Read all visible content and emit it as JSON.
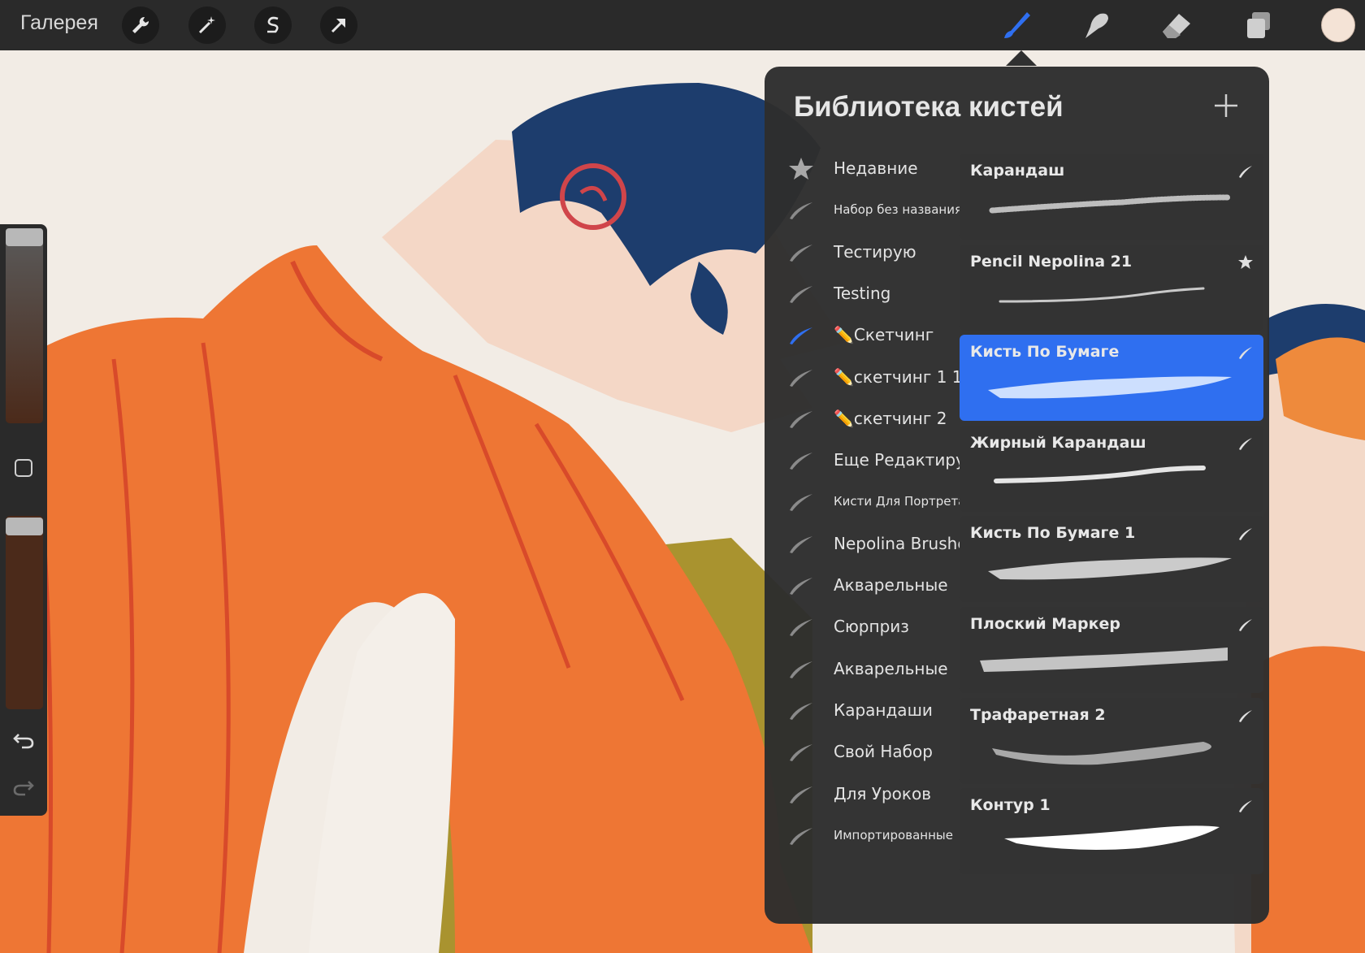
{
  "topbar": {
    "gallery_label": "Галерея",
    "left_tools": [
      "wrench-icon",
      "magic-wand-icon",
      "selection-s-icon",
      "transform-arrow-icon"
    ],
    "right_tools": [
      "brush-icon",
      "smudge-icon",
      "eraser-icon",
      "layers-icon"
    ],
    "current_color": "#f4e3d6",
    "active_tool_color": "#2f6ff0"
  },
  "sidebar": {
    "controls": [
      "brush-size-slider",
      "modify-button",
      "opacity-slider",
      "undo-icon",
      "redo-icon"
    ]
  },
  "brush_library": {
    "title": "Библиотека кистей",
    "add_icon": "plus-icon",
    "sets": [
      {
        "label": "Недавние",
        "icon": "star-icon",
        "small": false,
        "active": false
      },
      {
        "label": "Набор без названия",
        "icon": "brush-stroke-icon",
        "small": true,
        "active": false
      },
      {
        "label": "Тестирую",
        "icon": "brush-stroke-icon",
        "small": false,
        "active": false
      },
      {
        "label": "Testing",
        "icon": "brush-stroke-icon",
        "small": false,
        "active": false
      },
      {
        "label": "✏️Скетчинг",
        "icon": "brush-stroke-icon",
        "small": false,
        "active": true
      },
      {
        "label": "✏️скетчинг 1 1",
        "icon": "brush-stroke-icon",
        "small": false,
        "active": false
      },
      {
        "label": "✏️скетчинг 2",
        "icon": "brush-stroke-icon",
        "small": false,
        "active": false
      },
      {
        "label": "Еще Редактирую",
        "icon": "brush-stroke-icon",
        "small": false,
        "active": false
      },
      {
        "label": "Кисти Для Портрета",
        "icon": "brush-stroke-icon",
        "small": true,
        "active": false
      },
      {
        "label": "Nepolina Brushes",
        "icon": "brush-stroke-icon",
        "small": false,
        "active": false
      },
      {
        "label": "Акварельные",
        "icon": "brush-stroke-icon",
        "small": false,
        "active": false
      },
      {
        "label": "Сюрприз",
        "icon": "brush-stroke-icon",
        "small": false,
        "active": false
      },
      {
        "label": "Акварельные",
        "icon": "brush-stroke-icon",
        "small": false,
        "active": false
      },
      {
        "label": "Карандаши",
        "icon": "brush-stroke-icon",
        "small": false,
        "active": false
      },
      {
        "label": "Свой Набор",
        "icon": "brush-stroke-icon",
        "small": false,
        "active": false
      },
      {
        "label": "Для Уроков",
        "icon": "brush-stroke-icon",
        "small": false,
        "active": false
      },
      {
        "label": "Импортированные",
        "icon": "brush-stroke-icon",
        "small": true,
        "active": false
      }
    ],
    "brushes": [
      {
        "name": "Карандаш",
        "icon": "brush-stroke-icon",
        "selected": false,
        "stroke": "pencil"
      },
      {
        "name": "Pencil Nepolina 21",
        "icon": "star-icon",
        "selected": false,
        "stroke": "thin"
      },
      {
        "name": "Кисть По Бумаге",
        "icon": "brush-stroke-icon",
        "selected": true,
        "stroke": "paper"
      },
      {
        "name": "Жирный Карандаш",
        "icon": "brush-stroke-icon",
        "selected": false,
        "stroke": "bold-pencil"
      },
      {
        "name": "Кисть По Бумаге  1",
        "icon": "brush-stroke-icon",
        "selected": false,
        "stroke": "paper"
      },
      {
        "name": "Плоский Маркер",
        "icon": "brush-stroke-icon",
        "selected": false,
        "stroke": "marker"
      },
      {
        "name": "Трафаретная 2",
        "icon": "brush-stroke-icon",
        "selected": false,
        "stroke": "stencil"
      },
      {
        "name": "Контур 1",
        "icon": "brush-stroke-icon",
        "selected": false,
        "stroke": "contour"
      }
    ]
  }
}
